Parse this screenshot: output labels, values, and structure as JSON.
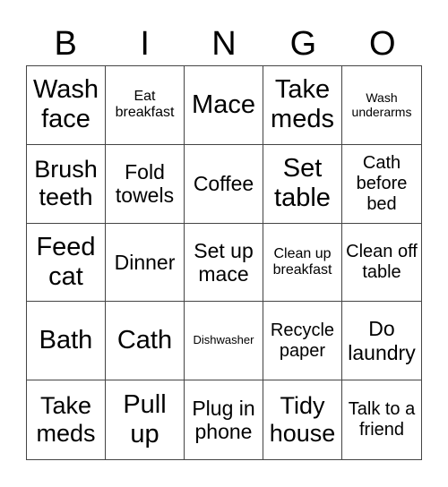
{
  "header": {
    "letters": [
      "B",
      "I",
      "N",
      "G",
      "O"
    ]
  },
  "cells": [
    {
      "text": "Wash face",
      "size": "s-xl"
    },
    {
      "text": "Eat breakfast",
      "size": "s-xs"
    },
    {
      "text": "Mace",
      "size": "s-xl"
    },
    {
      "text": "Take meds",
      "size": "s-xl"
    },
    {
      "text": "Wash underarms",
      "size": "s-xxs"
    },
    {
      "text": "Brush teeth",
      "size": "s-l"
    },
    {
      "text": "Fold towels",
      "size": "s-m"
    },
    {
      "text": "Coffee",
      "size": "s-m"
    },
    {
      "text": "Set table",
      "size": "s-xl"
    },
    {
      "text": "Cath before bed",
      "size": "s-s"
    },
    {
      "text": "Feed cat",
      "size": "s-xl"
    },
    {
      "text": "Dinner",
      "size": "s-m"
    },
    {
      "text": "Set up mace",
      "size": "s-m"
    },
    {
      "text": "Clean up breakfast",
      "size": "s-xs"
    },
    {
      "text": "Clean off table",
      "size": "s-s"
    },
    {
      "text": "Bath",
      "size": "s-xl"
    },
    {
      "text": "Cath",
      "size": "s-xl"
    },
    {
      "text": "Dishwasher",
      "size": "s-tiny"
    },
    {
      "text": "Recycle paper",
      "size": "s-s"
    },
    {
      "text": "Do laundry",
      "size": "s-m"
    },
    {
      "text": "Take meds",
      "size": "s-l"
    },
    {
      "text": "Pull up",
      "size": "s-xl"
    },
    {
      "text": "Plug in phone",
      "size": "s-m"
    },
    {
      "text": "Tidy house",
      "size": "s-l"
    },
    {
      "text": "Talk to a friend",
      "size": "s-s"
    }
  ]
}
